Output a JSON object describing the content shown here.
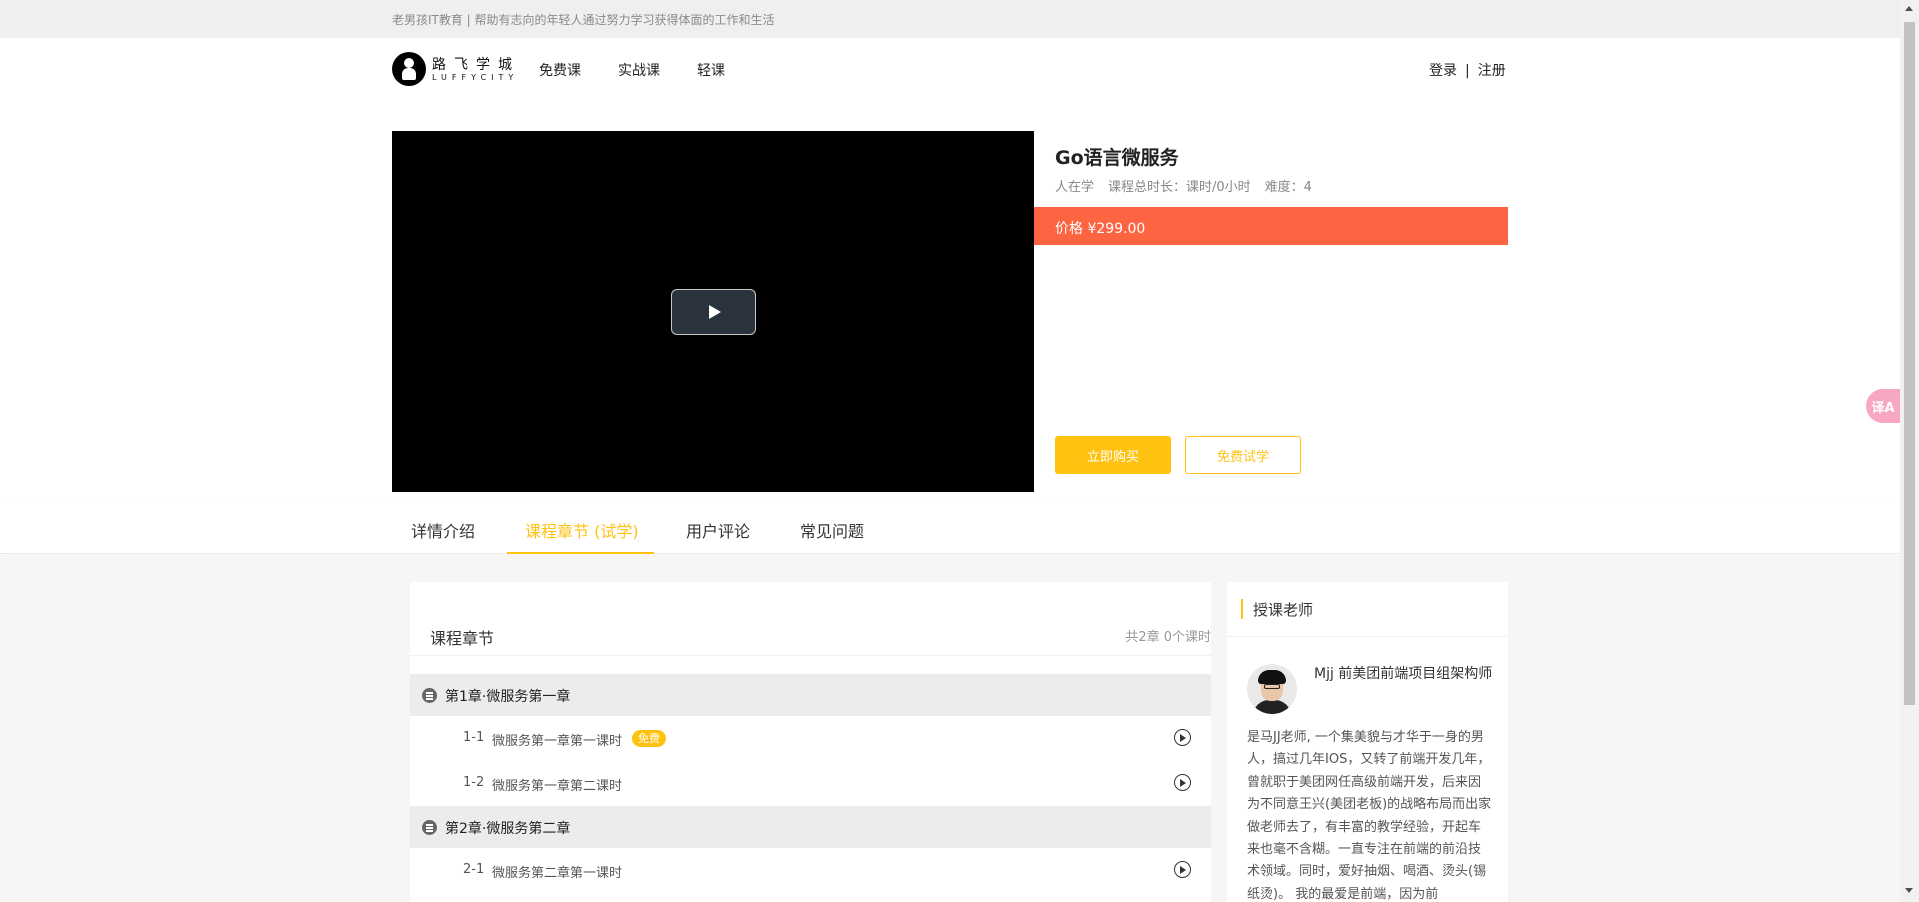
{
  "banner": {
    "text": "老男孩IT教育 | 帮助有志向的年轻人通过努力学习获得体面的工作和生活"
  },
  "logo": {
    "cn": "路飞学城",
    "en": "LUFFYCITY"
  },
  "nav": {
    "items": [
      "免费课",
      "实战课",
      "轻课"
    ]
  },
  "auth": {
    "login": "登录",
    "separator": "|",
    "register": "注册"
  },
  "course": {
    "title": "Go语言微服务",
    "meta": {
      "students": "人在学",
      "duration": "课程总时长：课时/0小时",
      "difficulty": "难度：4"
    },
    "price": "价格 ¥299.00",
    "buy_label": "立即购买",
    "trial_label": "免费试学",
    "accent_color": "#ffc210",
    "price_color": "#fd6442"
  },
  "tabs": [
    "详情介绍",
    "课程章节 (试学)",
    "用户评论",
    "常见问题"
  ],
  "tabs_active": 1,
  "chapters": {
    "heading": "课程章节",
    "count": "共2章 0个课时",
    "list": [
      {
        "title": "第1章·微服务第一章",
        "lessons": [
          {
            "num": "1-1",
            "title": "微服务第一章第一课时",
            "badge": "免费"
          },
          {
            "num": "1-2",
            "title": "微服务第一章第二课时",
            "badge": ""
          }
        ]
      },
      {
        "title": "第2章·微服务第二章",
        "lessons": [
          {
            "num": "2-1",
            "title": "微服务第二章第一课时",
            "badge": ""
          }
        ]
      }
    ]
  },
  "teacher": {
    "heading": "授课老师",
    "name": "Mjj 前美团前端项目组架构师",
    "bio": "是马JJ老师, 一个集美貌与才华于一身的男人，搞过几年IOS，又转了前端开发几年，曾就职于美团网任高级前端开发，后来因为不同意王兴(美团老板)的战略布局而出家做老师去了，有丰富的教学经验，开起车来也毫不含糊。一直专注在前端的前沿技术领域。同时，爱好抽烟、喝酒、烫头(锡纸烫)。 我的最爱是前端，因为前"
  },
  "icons": {
    "play": "play-icon",
    "chapter": "list-icon",
    "lesson_play": "play-circle-icon",
    "translate": "translate-icon"
  },
  "translate_widget": {
    "label": "译A"
  }
}
